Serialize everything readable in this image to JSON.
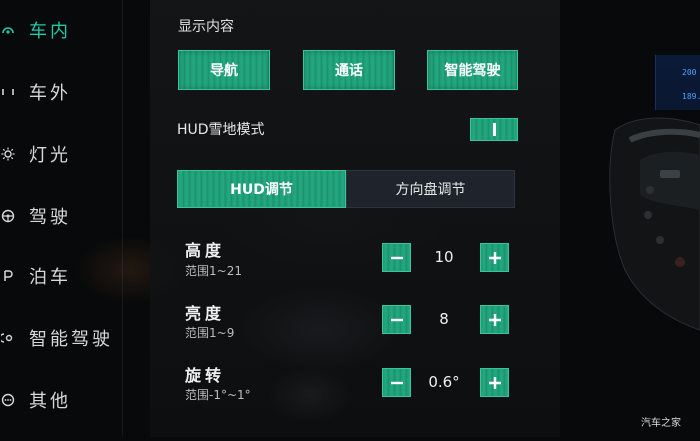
{
  "sidebar": {
    "items": [
      {
        "label": "车内",
        "icon": "car-interior-icon",
        "active": true
      },
      {
        "label": "车外",
        "icon": "car-exterior-icon"
      },
      {
        "label": "灯光",
        "icon": "light-icon"
      },
      {
        "label": "驾驶",
        "icon": "steering-wheel-icon"
      },
      {
        "label": "泊车",
        "icon": "parking-icon"
      },
      {
        "label": "智能驾驶",
        "icon": "smart-driving-icon"
      },
      {
        "label": "其他",
        "icon": "other-icon"
      }
    ]
  },
  "display": {
    "title": "显示内容",
    "buttons": [
      "导航",
      "通话",
      "智能驾驶"
    ]
  },
  "hud_snow": {
    "label": "HUD雪地模式",
    "toggle_on": true
  },
  "tabs": [
    {
      "label": "HUD调节",
      "active": true
    },
    {
      "label": "方向盘调节",
      "active": false
    }
  ],
  "adjust": [
    {
      "title": "高度",
      "range": "范围1~21",
      "value": "10"
    },
    {
      "title": "亮度",
      "range": "范围1~9",
      "value": "8"
    },
    {
      "title": "旋转",
      "range": "范围-1°~1°",
      "value": "0.6°"
    }
  ],
  "dashboard": {
    "line1": "200",
    "line2": "189."
  },
  "watermark": "汽车之家",
  "colors": {
    "accent": "#23a980",
    "accent_text": "#20c9a8",
    "background": "#07090a"
  }
}
